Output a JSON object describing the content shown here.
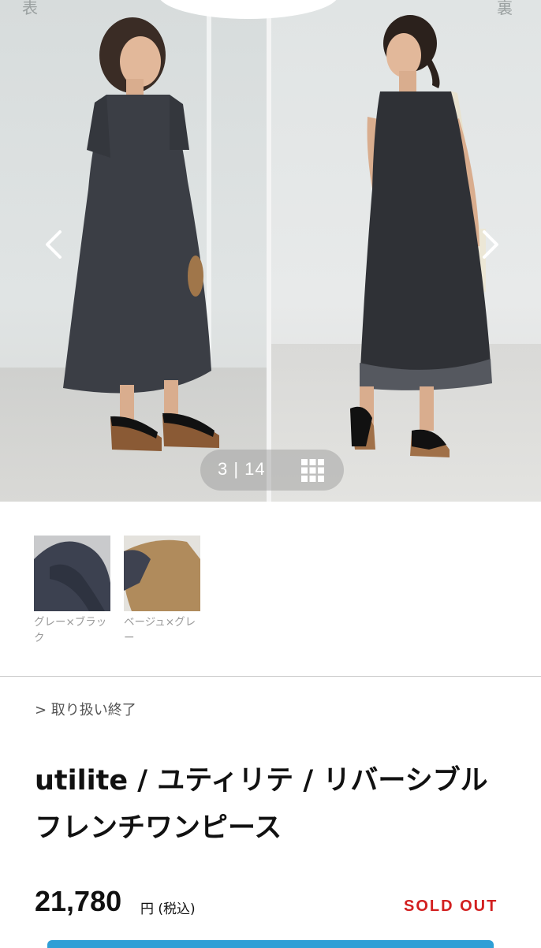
{
  "gallery": {
    "left_corner_label": "表",
    "right_corner_label": "裏",
    "counter": "3 | 14"
  },
  "icons": {
    "prev": "chevron-left-icon",
    "next": "chevron-right-icon",
    "grid": "grid-icon"
  },
  "swatches": [
    {
      "label": "グレー×ブラック"
    },
    {
      "label": "ベージュ×グレー"
    }
  ],
  "breadcrumb": "> 取り扱い終了",
  "product": {
    "title": "utilite / ユティリテ / リバーシブルフレンチワンピース",
    "price": "21,780",
    "price_unit": "円 (税込)",
    "status": "SOLD OUT"
  },
  "colors": {
    "sold_out": "#d21f1f",
    "accent_bar": "#2f9fd6"
  }
}
